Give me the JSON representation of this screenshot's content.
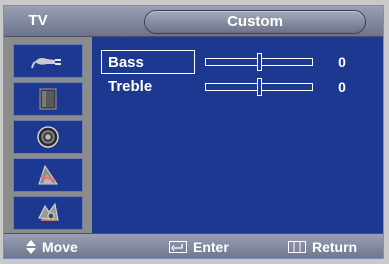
{
  "header": {
    "tv_label": "TV",
    "title": "Custom"
  },
  "sidebar": {
    "items": [
      {
        "icon": "input-plug-icon"
      },
      {
        "icon": "picture-icon"
      },
      {
        "icon": "sound-speaker-icon"
      },
      {
        "icon": "channel-icon"
      },
      {
        "icon": "setup-icon"
      }
    ]
  },
  "settings": [
    {
      "label": "Bass",
      "value": "0",
      "level": 0.5,
      "selected": true
    },
    {
      "label": "Treble",
      "value": "0",
      "level": 0.5,
      "selected": false
    }
  ],
  "footer": {
    "move_label": "Move",
    "enter_label": "Enter",
    "return_label": "Return"
  },
  "colors": {
    "background": "#1c3890",
    "bar": "#7d8398",
    "sidebar": "#8c8c8c",
    "text": "#ffffff"
  }
}
